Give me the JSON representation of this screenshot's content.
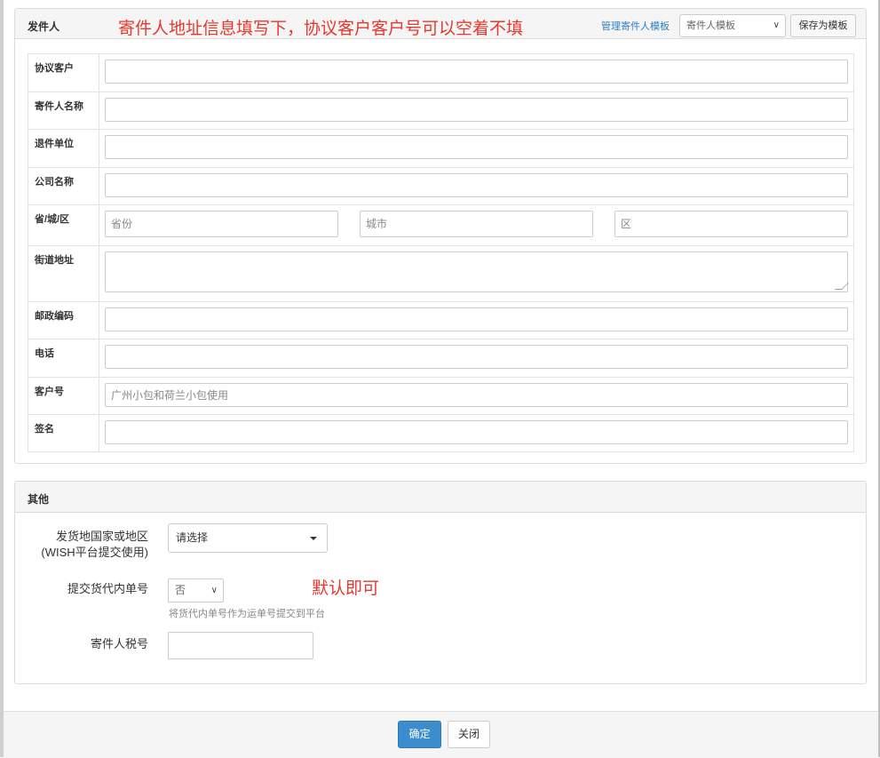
{
  "sender_panel": {
    "title": "发件人",
    "note": "寄件人地址信息填写下，协议客户客户号可以空着不填",
    "manage_link": "管理寄件人模板",
    "template_select": "寄件人模板",
    "save_template_button": "保存为模板",
    "fields": {
      "agreement_customer": {
        "label": "协议客户",
        "value": ""
      },
      "sender_name": {
        "label": "寄件人名称",
        "value": ""
      },
      "return_unit": {
        "label": "退件单位",
        "value": ""
      },
      "company_name": {
        "label": "公司名称",
        "value": ""
      },
      "region": {
        "label": "省/城/区",
        "province_placeholder": "省份",
        "city_placeholder": "城市",
        "district_placeholder": "区"
      },
      "street": {
        "label": "街道地址",
        "value": ""
      },
      "postcode": {
        "label": "邮政编码",
        "value": ""
      },
      "phone": {
        "label": "电话",
        "value": ""
      },
      "customer_no": {
        "label": "客户号",
        "placeholder": "广州小包和荷兰小包使用"
      },
      "signature": {
        "label": "签名",
        "value": ""
      }
    }
  },
  "other_panel": {
    "title": "其他",
    "country_label_line1": "发货地国家或地区",
    "country_label_line2": "(WISH平台提交使用)",
    "country_select": "请选择",
    "forwarder_label": "提交货代内单号",
    "forwarder_select": "否",
    "forwarder_help": "将货代内单号作为运单号提交到平台",
    "note": "默认即可",
    "tax_label": "寄件人税号",
    "tax_value": ""
  },
  "footer": {
    "confirm_button": "确定",
    "close_button": "关闭"
  },
  "colors": {
    "primary": "#3c8dcd",
    "annotation_red": "#e8382d",
    "link": "#2f7ec2"
  }
}
